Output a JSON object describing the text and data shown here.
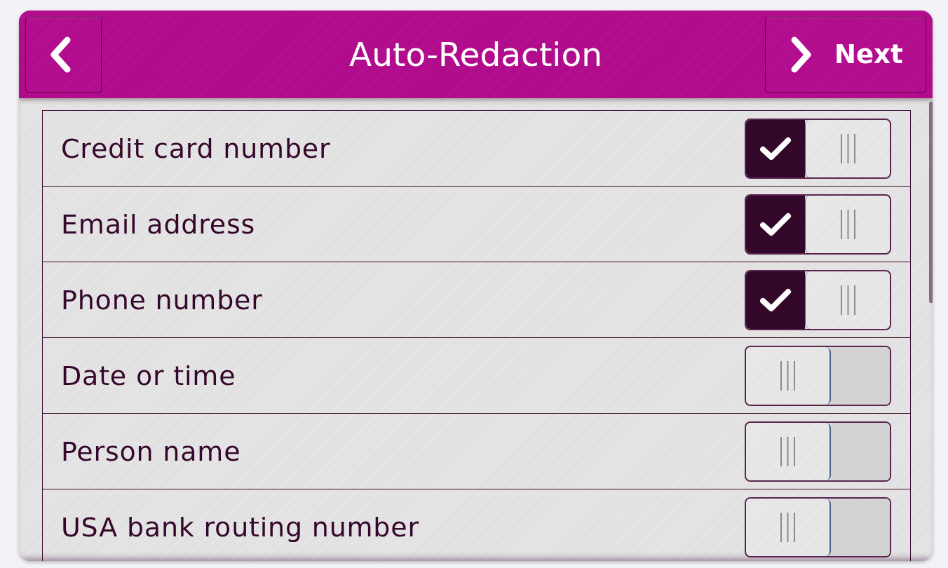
{
  "header": {
    "title": "Auto-Redaction",
    "next_button": {
      "label": "Next"
    }
  },
  "items": [
    {
      "label": "Credit card number",
      "checked": true
    },
    {
      "label": "Email address",
      "checked": true
    },
    {
      "label": "Phone number",
      "checked": true
    },
    {
      "label": "Date or time",
      "checked": false
    },
    {
      "label": "Person name",
      "checked": false
    },
    {
      "label": "USA bank routing number",
      "checked": false
    }
  ]
}
